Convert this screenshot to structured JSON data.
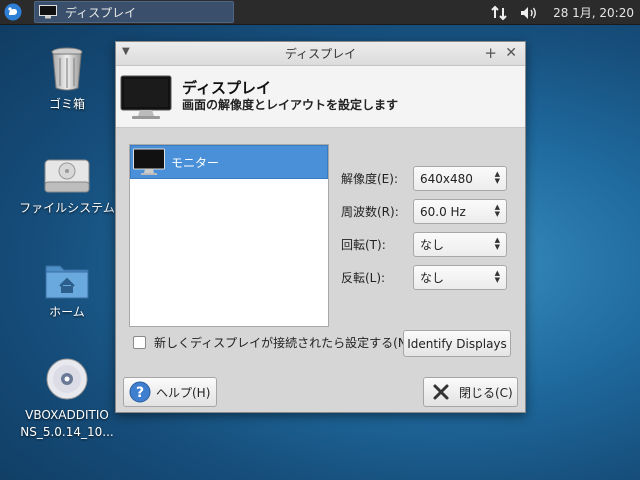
{
  "panel": {
    "task_title": "ディスプレイ",
    "clock": "28 1月, 20:20"
  },
  "desktop": {
    "icons": [
      {
        "label": "ゴミ箱"
      },
      {
        "label": "ファイルシステム"
      },
      {
        "label": "ホーム"
      },
      {
        "label_line1": "VBOXADDITIO",
        "label_line2": "NS_5.0.14_10..."
      }
    ]
  },
  "dialog": {
    "title": "ディスプレイ",
    "header_title": "ディスプレイ",
    "header_subtitle": "画面の解像度とレイアウトを設定します",
    "monitor_name": "モニター",
    "settings": [
      {
        "label": "解像度(E):",
        "value": "640x480"
      },
      {
        "label": "周波数(R):",
        "value": "60.0 Hz"
      },
      {
        "label": "回転(T):",
        "value": "なし"
      },
      {
        "label": "反転(L):",
        "value": "なし"
      }
    ],
    "checkbox_label": "新しくディスプレイが接続されたら設定する(N)",
    "identify_button": "Identify Displays",
    "help_button": "ヘルプ(H)",
    "close_button": "閉じる(C)"
  },
  "colors": {
    "selection": "#4a90d9",
    "panel": "#2b2b2b",
    "desktop": "#1f6a9e"
  }
}
